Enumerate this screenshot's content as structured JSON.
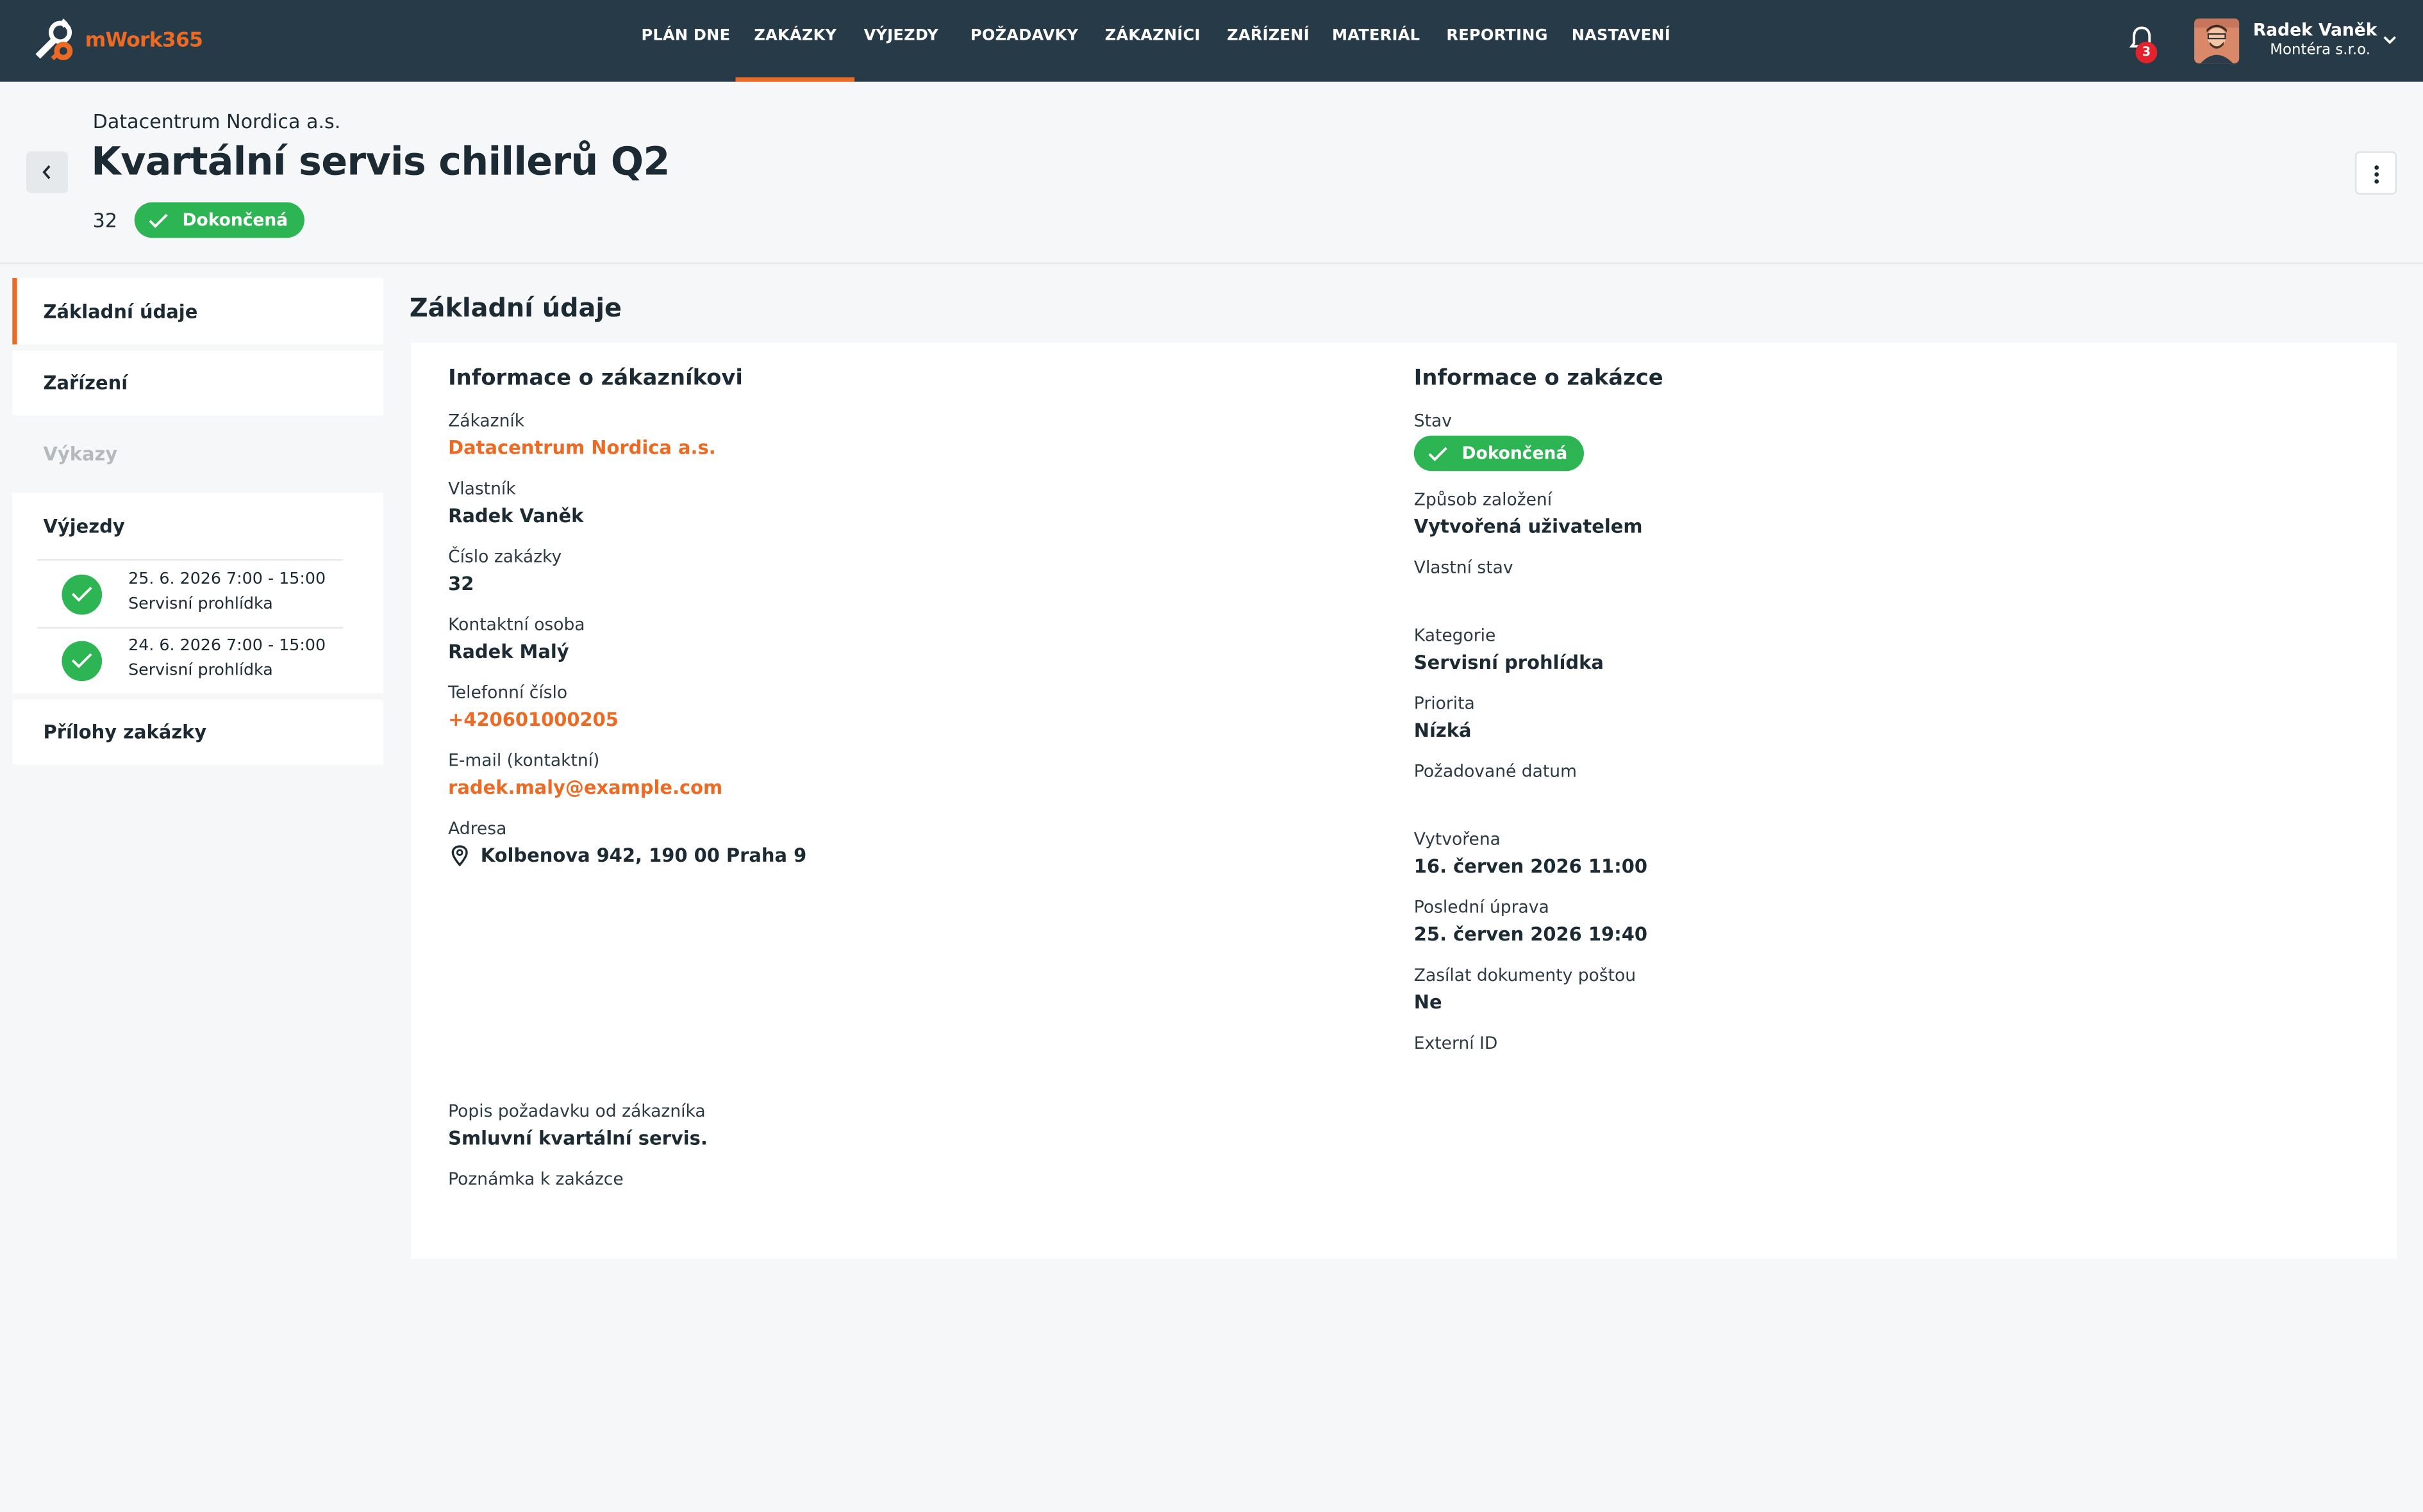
{
  "app": {
    "logo_text": "mWork365",
    "brand_color": "#ec6a23",
    "nav_bg": "#263a48"
  },
  "nav": {
    "items": [
      "PLÁN DNE",
      "ZAKÁZKY",
      "VÝJEZDY",
      "POŽADAVKY",
      "ZÁKAZNÍCI",
      "ZAŘÍZENÍ",
      "MATERIÁL",
      "REPORTING",
      "NASTAVENÍ"
    ],
    "active": "ZAKÁZKY"
  },
  "notifications": {
    "icon": "bell-icon",
    "count": "3"
  },
  "user": {
    "name": "Radek Vaněk",
    "company": "Montéra s.r.o."
  },
  "header": {
    "customer": "Datacentrum Nordica a.s.",
    "title": "Kvartální servis chillerů Q2",
    "number": "32",
    "status": "Dokončená",
    "status_color": "#2db553"
  },
  "sidebar": {
    "basic": "Základní údaje",
    "devices": "Zařízení",
    "reports": "Výkazy",
    "trips_title": "Výjezdy",
    "trips": [
      {
        "date": "25. 6. 2026 7:00 - 15:00",
        "type": "Servisní prohlídka"
      },
      {
        "date": "24. 6. 2026 7:00 - 15:00",
        "type": "Servisní prohlídka"
      }
    ],
    "attachments": "Přílohy zakázky"
  },
  "main": {
    "section_title": "Základní údaje",
    "customer_info": {
      "title": "Informace o zákazníkovi",
      "customer_label": "Zákazník",
      "customer_value": "Datacentrum Nordica a.s.",
      "owner_label": "Vlastník",
      "owner_value": "Radek Vaněk",
      "number_label": "Číslo zakázky",
      "number_value": "32",
      "contact_label": "Kontaktní osoba",
      "contact_value": "Radek Malý",
      "phone_label": "Telefonní číslo",
      "phone_value": "+420601000205",
      "email_label": "E-mail (kontaktní)",
      "email_value": "radek.maly@example.com",
      "address_label": "Adresa",
      "address_value": "Kolbenova 942, 190 00 Praha 9",
      "request_label": "Popis požadavku od zákazníka",
      "request_value": "Smluvní kvartální servis.",
      "note_label": "Poznámka k zakázce"
    },
    "order_info": {
      "title": "Informace o zakázce",
      "status_label": "Stav",
      "status_value": "Dokončená",
      "origin_label": "Způsob založení",
      "origin_value": "Vytvořená uživatelem",
      "custom_status_label": "Vlastní stav",
      "category_label": "Kategorie",
      "category_value": "Servisní prohlídka",
      "priority_label": "Priorita",
      "priority_value": "Nízká",
      "required_date_label": "Požadované datum",
      "created_label": "Vytvořena",
      "created_value": "16. červen 2026 11:00",
      "modified_label": "Poslední úprava",
      "modified_value": "25. červen 2026 19:40",
      "mail_docs_label": "Zasílat dokumenty poštou",
      "mail_docs_value": "Ne",
      "external_id_label": "Externí ID"
    }
  }
}
